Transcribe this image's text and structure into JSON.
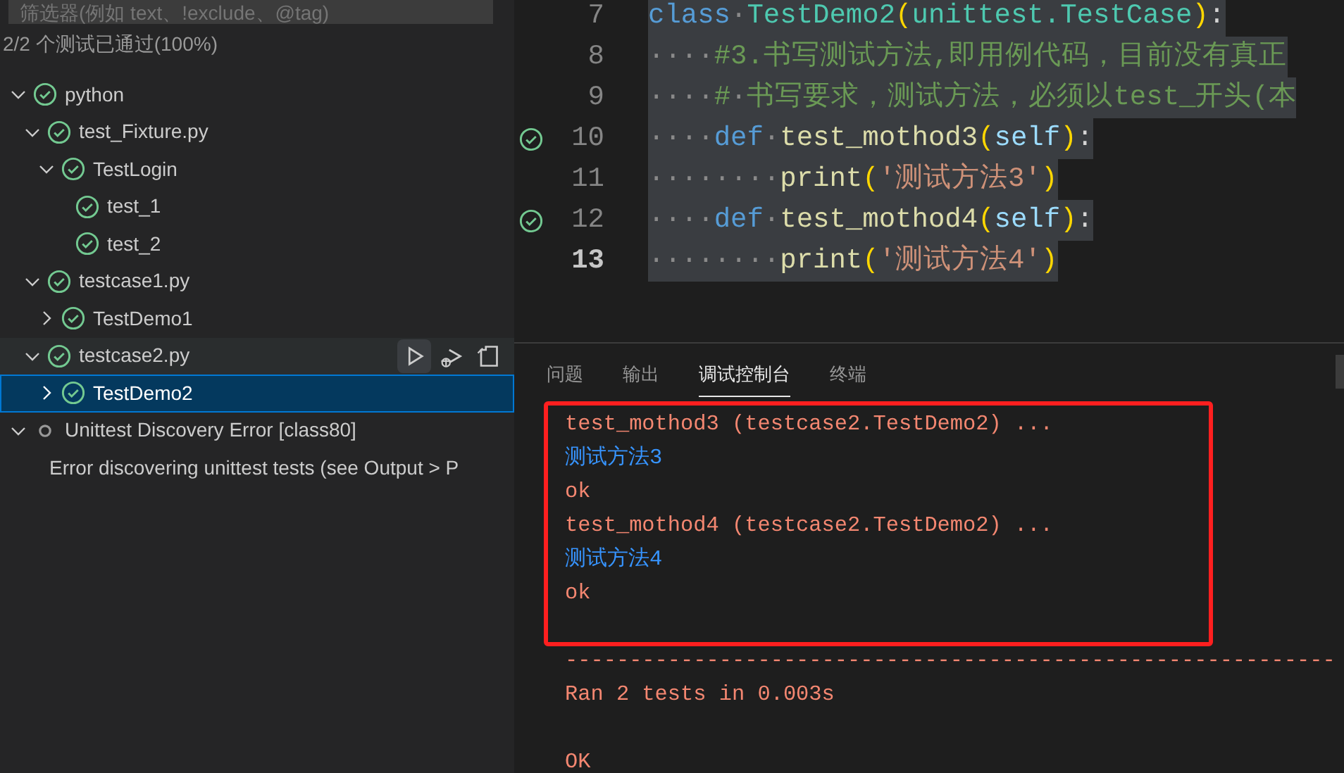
{
  "sidebar": {
    "filter": {
      "placeholder": "筛选器(例如 text、!exclude、@tag)"
    },
    "summary": "2/2 个测试已通过(100%)",
    "tree": [
      {
        "label": "python",
        "kind": "passed",
        "expanded": true,
        "selected": false,
        "hovered": false,
        "children": [
          {
            "label": "test_Fixture.py",
            "kind": "passed",
            "expanded": true,
            "selected": false,
            "hovered": false,
            "children": [
              {
                "label": "TestLogin",
                "kind": "passed",
                "expanded": true,
                "selected": false,
                "hovered": false,
                "children": [
                  {
                    "label": "test_1",
                    "kind": "passed",
                    "selected": false,
                    "hovered": false
                  },
                  {
                    "label": "test_2",
                    "kind": "passed",
                    "selected": false,
                    "hovered": false
                  }
                ]
              }
            ]
          },
          {
            "label": "testcase1.py",
            "kind": "passed",
            "expanded": true,
            "selected": false,
            "hovered": false,
            "children": [
              {
                "label": "TestDemo1",
                "kind": "passed",
                "expanded": false,
                "selected": false,
                "hovered": false
              }
            ]
          },
          {
            "label": "testcase2.py",
            "kind": "passed",
            "expanded": true,
            "selected": false,
            "hovered": true,
            "children": [
              {
                "label": "TestDemo2",
                "kind": "passed",
                "expanded": false,
                "selected": true,
                "hovered": false
              }
            ]
          }
        ]
      },
      {
        "label": "Unittest Discovery Error [class80]",
        "kind": "unknown",
        "expanded": true,
        "selected": false,
        "hovered": false,
        "children": [
          {
            "label": "Error discovering unittest tests (see Output > P",
            "kind": "message",
            "selected": false,
            "hovered": false
          }
        ]
      }
    ]
  },
  "editor": {
    "lines": [
      {
        "number": "7",
        "passed": false,
        "current": false,
        "tokens": [
          {
            "kind": "keyword",
            "text": "class"
          },
          {
            "kind": "whitespace",
            "text": "·"
          },
          {
            "kind": "class",
            "text": "TestDemo2"
          },
          {
            "kind": "bracket",
            "text": "("
          },
          {
            "kind": "class",
            "text": "unittest.TestCase"
          },
          {
            "kind": "bracket",
            "text": ")"
          },
          {
            "kind": "plain",
            "text": ":"
          }
        ]
      },
      {
        "number": "8",
        "passed": false,
        "current": false,
        "tokens": [
          {
            "kind": "whitespace",
            "text": "····"
          },
          {
            "kind": "comment",
            "text": "#3.书写测试方法,即用例代码，目前没有真正"
          }
        ]
      },
      {
        "number": "9",
        "passed": false,
        "current": false,
        "tokens": [
          {
            "kind": "whitespace",
            "text": "····"
          },
          {
            "kind": "comment",
            "text": "#"
          },
          {
            "kind": "whitespace",
            "text": "·"
          },
          {
            "kind": "comment",
            "text": "书写要求，测试方法，必须以test_开头(本"
          }
        ]
      },
      {
        "number": "10",
        "passed": true,
        "current": false,
        "tokens": [
          {
            "kind": "whitespace",
            "text": "····"
          },
          {
            "kind": "keyword",
            "text": "def"
          },
          {
            "kind": "whitespace",
            "text": "·"
          },
          {
            "kind": "func",
            "text": "test_mothod3"
          },
          {
            "kind": "bracket",
            "text": "("
          },
          {
            "kind": "param",
            "text": "self"
          },
          {
            "kind": "bracket",
            "text": ")"
          },
          {
            "kind": "plain",
            "text": ":"
          }
        ]
      },
      {
        "number": "11",
        "passed": false,
        "current": false,
        "tokens": [
          {
            "kind": "whitespace",
            "text": "········"
          },
          {
            "kind": "func",
            "text": "print"
          },
          {
            "kind": "bracket",
            "text": "("
          },
          {
            "kind": "string",
            "text": "'测试方法3'"
          },
          {
            "kind": "bracket",
            "text": ")"
          }
        ]
      },
      {
        "number": "12",
        "passed": true,
        "current": false,
        "tokens": [
          {
            "kind": "whitespace",
            "text": "····"
          },
          {
            "kind": "keyword",
            "text": "def"
          },
          {
            "kind": "whitespace",
            "text": "·"
          },
          {
            "kind": "func",
            "text": "test_mothod4"
          },
          {
            "kind": "bracket",
            "text": "("
          },
          {
            "kind": "param",
            "text": "self"
          },
          {
            "kind": "bracket",
            "text": ")"
          },
          {
            "kind": "plain",
            "text": ":"
          }
        ]
      },
      {
        "number": "13",
        "passed": false,
        "current": true,
        "tokens": [
          {
            "kind": "whitespace",
            "text": "········"
          },
          {
            "kind": "func",
            "text": "print"
          },
          {
            "kind": "bracket",
            "text": "("
          },
          {
            "kind": "string",
            "text": "'测试方法4'"
          },
          {
            "kind": "bracket",
            "text": ")"
          }
        ]
      }
    ]
  },
  "panel": {
    "tabs": [
      {
        "label": "问题",
        "selected": false
      },
      {
        "label": "输出",
        "selected": false
      },
      {
        "label": "调试控制台",
        "selected": true
      },
      {
        "label": "终端",
        "selected": false
      }
    ],
    "console": [
      {
        "kind": "stderr",
        "text": "test_mothod3 (testcase2.TestDemo2) ..."
      },
      {
        "kind": "stdout",
        "text": "测试方法3"
      },
      {
        "kind": "stderr",
        "text": "ok"
      },
      {
        "kind": "stderr",
        "text": "test_mothod4 (testcase2.TestDemo2) ..."
      },
      {
        "kind": "stdout",
        "text": "测试方法4"
      },
      {
        "kind": "stderr",
        "text": "ok"
      },
      {
        "kind": "blank"
      },
      {
        "kind": "stderr",
        "text": "------------------------------------------------------------"
      },
      {
        "kind": "stderr",
        "text": "Ran 2 tests in 0.003s"
      },
      {
        "kind": "blank"
      },
      {
        "kind": "stderr",
        "text": "OK"
      }
    ]
  }
}
